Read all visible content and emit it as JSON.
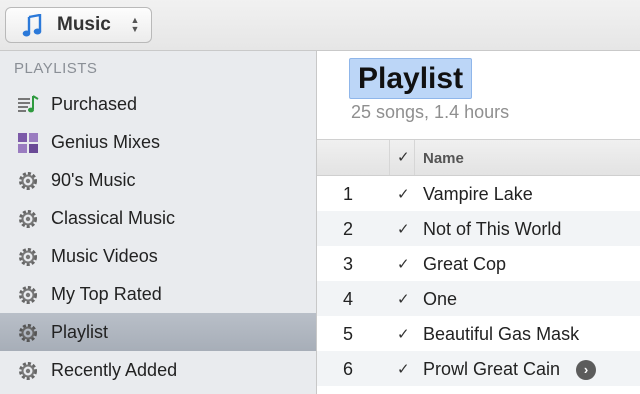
{
  "source_selector": {
    "label": "Music",
    "icon": "music-note-icon",
    "accent": "#2b79d9"
  },
  "sidebar": {
    "header": "PLAYLISTS",
    "items": [
      {
        "label": "Purchased",
        "icon": "purchased-list-icon"
      },
      {
        "label": "Genius Mixes",
        "icon": "genius-mixes-icon"
      },
      {
        "label": "90's Music",
        "icon": "gear-icon"
      },
      {
        "label": "Classical Music",
        "icon": "gear-icon"
      },
      {
        "label": "Music Videos",
        "icon": "gear-icon"
      },
      {
        "label": "My Top Rated",
        "icon": "gear-icon"
      },
      {
        "label": "Playlist",
        "icon": "gear-icon",
        "selected": true
      },
      {
        "label": "Recently Added",
        "icon": "gear-icon"
      }
    ]
  },
  "main": {
    "title": "Playlist",
    "subtitle": "25 songs, 1.4 hours"
  },
  "table": {
    "columns": {
      "check": "✓",
      "name": "Name"
    },
    "rows": [
      {
        "num": "1",
        "check": "✓",
        "name": "Vampire Lake"
      },
      {
        "num": "2",
        "check": "✓",
        "name": "Not of This World"
      },
      {
        "num": "3",
        "check": "✓",
        "name": "Great Cop"
      },
      {
        "num": "4",
        "check": "✓",
        "name": "One"
      },
      {
        "num": "5",
        "check": "✓",
        "name": "Beautiful Gas Mask"
      },
      {
        "num": "6",
        "check": "✓",
        "name": "Prowl Great Cain",
        "more": "›"
      }
    ]
  }
}
